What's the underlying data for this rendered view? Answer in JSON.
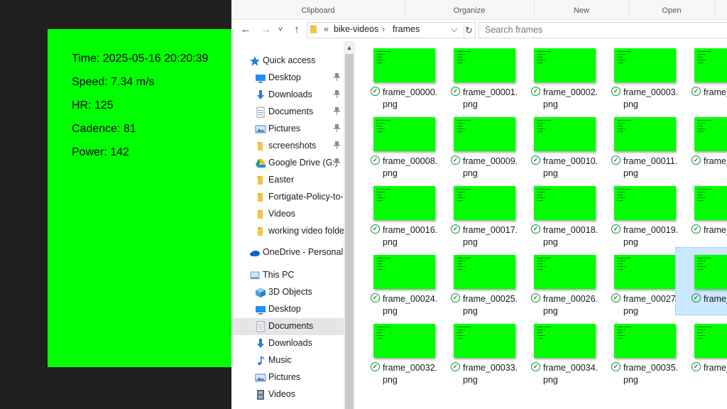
{
  "overlay": {
    "time": "Time: 2025-05-16 20:20:39",
    "speed": "Speed: 7.34 m/s",
    "hr": "HR: 125",
    "cadence": "Cadence: 81",
    "power": "Power: 142"
  },
  "ribbon": [
    "Clipboard",
    "Organize",
    "New",
    "Open"
  ],
  "nav": {
    "back": "←",
    "forward": "→",
    "recent": "˅",
    "up": "↑",
    "refresh": "↻",
    "dropdown": "⌵",
    "chevron": "«",
    "sep": "›"
  },
  "address": {
    "crumbs": [
      "bike-videos",
      "frames"
    ]
  },
  "search": {
    "placeholder": "Search frames"
  },
  "sidebar": [
    {
      "label": "Quick access",
      "icon": "star-icon",
      "color": "#2b7cd3",
      "top": true
    },
    {
      "label": "Desktop",
      "icon": "desktop-icon",
      "color": "#1e90ff",
      "pin": true
    },
    {
      "label": "Downloads",
      "icon": "download-icon",
      "color": "#2b7cd3",
      "pin": true
    },
    {
      "label": "Documents",
      "icon": "document-icon",
      "color": "#8c9bb0",
      "pin": true
    },
    {
      "label": "Pictures",
      "icon": "pictures-icon",
      "color": "#4a86c5",
      "pin": true
    },
    {
      "label": "screenshots",
      "icon": "folder-icon",
      "color": "#f3c545",
      "pin": true
    },
    {
      "label": "Google Drive (G:)",
      "icon": "google-drive-icon",
      "color": "#1fa463",
      "pin": true
    },
    {
      "label": "Easter",
      "icon": "folder-icon",
      "color": "#f3c545"
    },
    {
      "label": "Fortigate-Policy-to-T",
      "icon": "folder-icon",
      "color": "#f3c545"
    },
    {
      "label": "Videos",
      "icon": "folder-icon",
      "color": "#f3c545"
    },
    {
      "label": "working video folde",
      "icon": "folder-icon",
      "color": "#f3c545"
    },
    {
      "label": "OneDrive - Personal",
      "icon": "cloud-icon",
      "color": "#0a64c8",
      "top": true
    },
    {
      "label": "This PC",
      "icon": "computer-icon",
      "color": "#5b9bd5",
      "top": true
    },
    {
      "label": "3D Objects",
      "icon": "cube-icon",
      "color": "#4aa3df"
    },
    {
      "label": "Desktop",
      "icon": "desktop-icon",
      "color": "#1e90ff"
    },
    {
      "label": "Documents",
      "icon": "document-icon",
      "color": "#8c9bb0",
      "selected": true
    },
    {
      "label": "Downloads",
      "icon": "download-icon",
      "color": "#2b7cd3"
    },
    {
      "label": "Music",
      "icon": "music-icon",
      "color": "#2b7cd3"
    },
    {
      "label": "Pictures",
      "icon": "pictures-icon",
      "color": "#4a86c5"
    },
    {
      "label": "Videos",
      "icon": "video-icon",
      "color": "#5a6b7d"
    }
  ],
  "pin_glyph": "📌",
  "check_glyph": "✓",
  "files": [
    [
      "frame_00000.png",
      "frame_00001.png",
      "frame_00002.png",
      "frame_00003.png",
      "frame_"
    ],
    [
      "frame_00008.png",
      "frame_00009.png",
      "frame_00010.png",
      "frame_00011.png",
      "frame_"
    ],
    [
      "frame_00016.png",
      "frame_00017.png",
      "frame_00018.png",
      "frame_00019.png",
      "frame_"
    ],
    [
      "frame_00024.png",
      "frame_00025.png",
      "frame_00026.png",
      "frame_00027.png",
      "frame_"
    ],
    [
      "frame_00032.png",
      "frame_00033.png",
      "frame_00034.png",
      "frame_00035.png",
      "frame_"
    ]
  ],
  "selected_file": [
    3,
    4
  ],
  "colors": {
    "frame_green": "#00ff00",
    "selection": "#cce8ff"
  }
}
